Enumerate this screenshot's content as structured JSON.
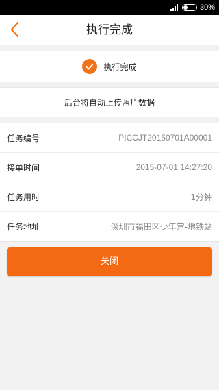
{
  "status_bar": {
    "battery": "30%"
  },
  "header": {
    "title": "执行完成"
  },
  "status": {
    "text": "执行完成"
  },
  "upload": {
    "text": "后台将自动上传照片数据"
  },
  "info": {
    "rows": [
      {
        "label": "任务编号",
        "value": "PICCJT20150701A00001"
      },
      {
        "label": "接单时间",
        "value": "2015-07-01 14:27:20"
      },
      {
        "label": "任务用时",
        "value": "1分钟"
      },
      {
        "label": "任务地址",
        "value": "深圳市福田区少年宫-地铁站"
      }
    ]
  },
  "actions": {
    "close_label": "关闭"
  },
  "colors": {
    "accent": "#f36a12",
    "check": "#f0731a"
  }
}
